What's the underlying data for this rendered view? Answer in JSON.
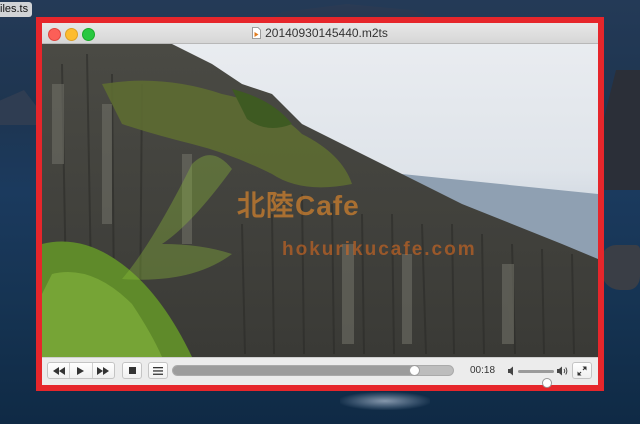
{
  "desktop": {
    "file_label": "iles.ts"
  },
  "window": {
    "title": "20140930145440.m2ts",
    "frame_color": "#e6262b"
  },
  "video": {
    "watermark_logo": "北陸Cafe",
    "watermark_url": "hokurikucafe.com"
  },
  "controls": {
    "rewind_icon": "rewind-icon",
    "play_icon": "play-icon",
    "forward_icon": "fast-forward-icon",
    "stop_icon": "stop-icon",
    "playlist_icon": "playlist-icon",
    "time": "00:18",
    "progress_fraction": 0.86,
    "volume_fraction": 0.8,
    "volume_low_icon": "volume-low-icon",
    "volume_high_icon": "volume-high-icon",
    "fullscreen_icon": "fullscreen-icon"
  }
}
